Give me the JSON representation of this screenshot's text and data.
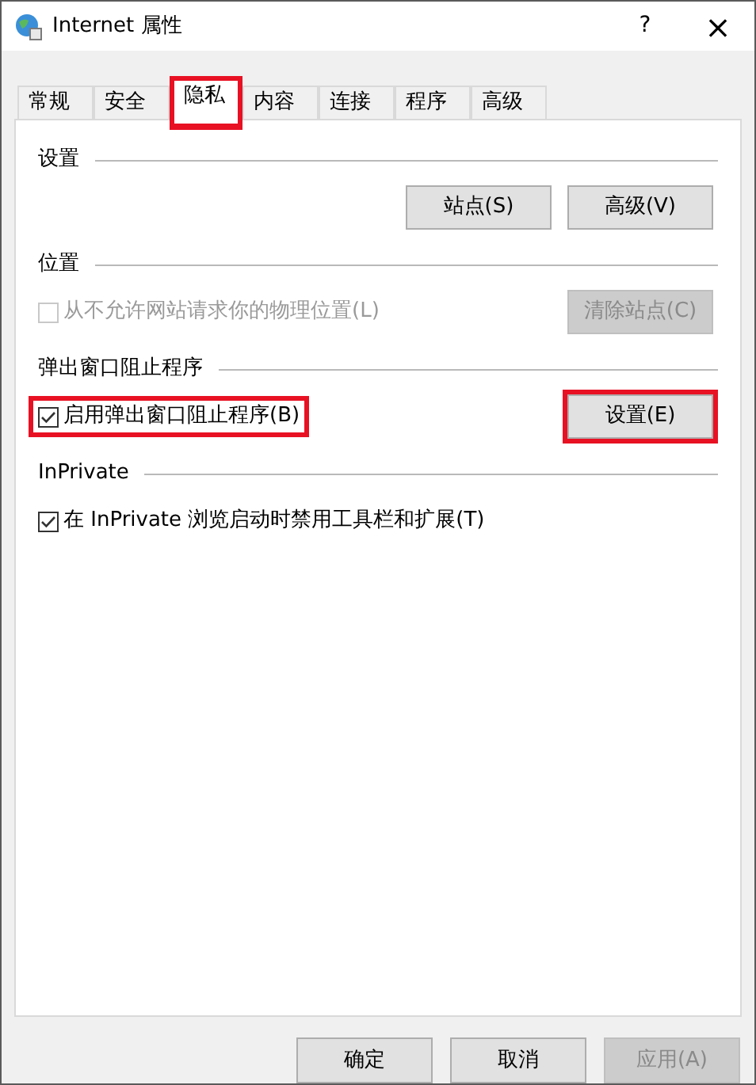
{
  "window": {
    "title": "Internet 属性",
    "help": "?",
    "close": "×"
  },
  "tabs": [
    {
      "label": "常规",
      "selected": false,
      "highlighted": false
    },
    {
      "label": "安全",
      "selected": false,
      "highlighted": false
    },
    {
      "label": "隐私",
      "selected": true,
      "highlighted": true
    },
    {
      "label": "内容",
      "selected": false,
      "highlighted": false
    },
    {
      "label": "连接",
      "selected": false,
      "highlighted": false
    },
    {
      "label": "程序",
      "selected": false,
      "highlighted": false
    },
    {
      "label": "高级",
      "selected": false,
      "highlighted": false
    }
  ],
  "sections": [
    {
      "title": "设置",
      "buttons": [
        {
          "label": "站点(S)",
          "disabled": false,
          "highlighted": false
        },
        {
          "label": "高级(V)",
          "disabled": false,
          "highlighted": false
        }
      ]
    },
    {
      "title": "位置",
      "checkbox": {
        "label": "从不允许网站请求你的物理位置(L)",
        "checked": false,
        "disabled": true,
        "highlighted": false
      },
      "buttons": [
        {
          "label": "清除站点(C)",
          "disabled": true,
          "highlighted": false
        }
      ]
    },
    {
      "title": "弹出窗口阻止程序",
      "checkbox": {
        "label": "启用弹出窗口阻止程序(B)",
        "checked": true,
        "disabled": false,
        "highlighted": true
      },
      "buttons": [
        {
          "label": "设置(E)",
          "disabled": false,
          "highlighted": true
        }
      ]
    },
    {
      "title": "InPrivate",
      "checkbox": {
        "label": "在 InPrivate 浏览启动时禁用工具栏和扩展(T)",
        "checked": true,
        "disabled": false,
        "highlighted": false
      }
    }
  ],
  "footer_buttons": [
    {
      "label": "确定",
      "disabled": false
    },
    {
      "label": "取消",
      "disabled": false
    },
    {
      "label": "应用(A)",
      "disabled": true
    }
  ]
}
